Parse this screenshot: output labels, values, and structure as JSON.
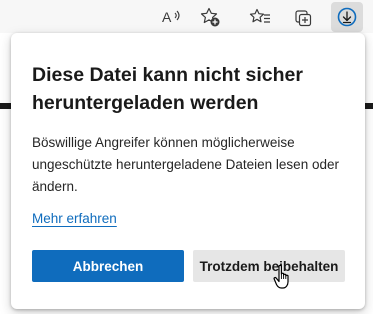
{
  "toolbar": {
    "icons": [
      "read-aloud-icon",
      "add-to-favorites-icon",
      "favorites-icon",
      "collections-icon",
      "downloads-icon"
    ]
  },
  "dialog": {
    "title": "Diese Datei kann nicht sicher heruntergeladen werden",
    "message": "Böswillige Angreifer können möglicherweise ungeschützte heruntergeladene Dateien lesen oder ändern.",
    "learn_more": "Mehr erfahren",
    "cancel_label": "Abbrechen",
    "keep_label": "Trotzdem beibehalten"
  },
  "colors": {
    "accent": "#0f6cbd",
    "secondary_button": "#e6e6e6",
    "toolbar_bg": "#f7f7f7"
  }
}
